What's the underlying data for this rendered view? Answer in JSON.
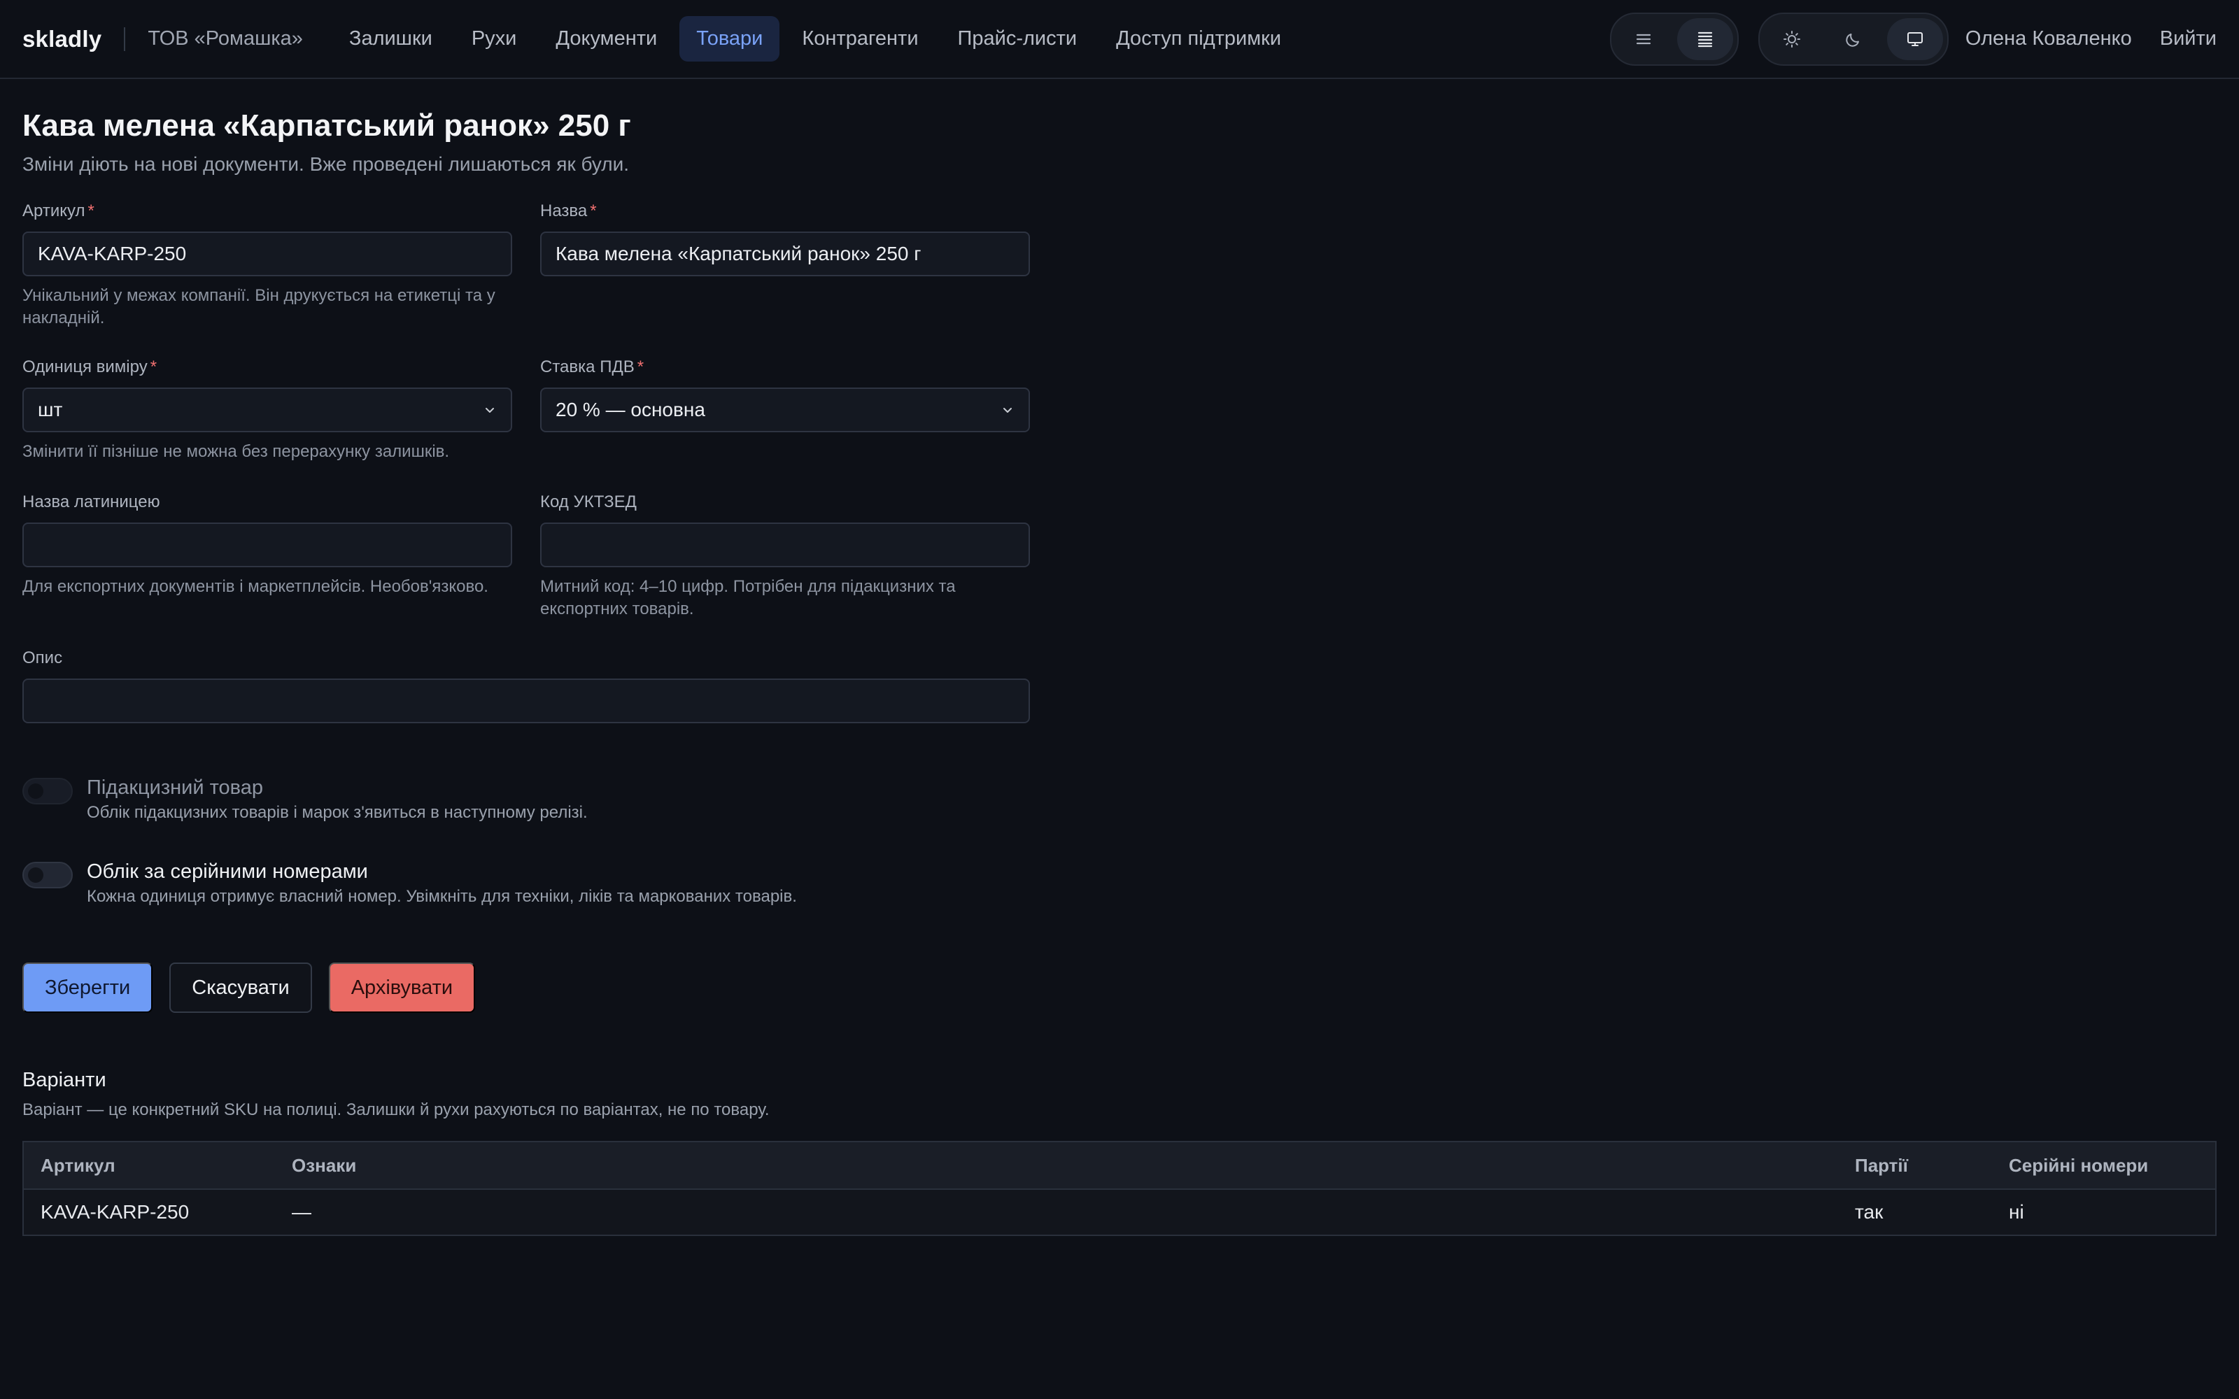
{
  "header": {
    "brand": "skladly",
    "company": "ТОВ «Ромашка»",
    "nav": [
      {
        "label": "Залишки"
      },
      {
        "label": "Рухи"
      },
      {
        "label": "Документи"
      },
      {
        "label": "Товари",
        "active": true
      },
      {
        "label": "Контрагенти"
      },
      {
        "label": "Прайс-листи"
      },
      {
        "label": "Доступ підтримки"
      }
    ],
    "density_icons": [
      "list-compact-icon",
      "list-dense-icon"
    ],
    "theme_icons": [
      "sun-icon",
      "moon-icon",
      "monitor-icon"
    ],
    "user": "Олена Коваленко",
    "logout": "Вийти"
  },
  "page": {
    "title": "Кава мелена «Карпатський ранок» 250 г",
    "subtitle": "Зміни діють на нові документи. Вже проведені лишаються як були."
  },
  "form": {
    "sku": {
      "label": "Артикул",
      "required": "*",
      "value": "KAVA-KARP-250",
      "hint": "Унікальний у межах компанії. Він друкується на етикетці та у накладній."
    },
    "name": {
      "label": "Назва",
      "required": "*",
      "value": "Кава мелена «Карпатський ранок» 250 г"
    },
    "unit": {
      "label": "Одиниця виміру",
      "required": "*",
      "value": "шт",
      "hint": "Змінити її пізніше не можна без перерахунку залишків."
    },
    "vat": {
      "label": "Ставка ПДВ",
      "required": "*",
      "value": "20 % — основна"
    },
    "latin_name": {
      "label": "Назва латиницею",
      "value": "",
      "hint": "Для експортних документів і маркетплейсів. Необов'язково."
    },
    "uktzed": {
      "label": "Код УКТЗЕД",
      "value": "",
      "hint": "Митний код: 4–10 цифр. Потрібен для підакцизних та експортних товарів."
    },
    "description": {
      "label": "Опис",
      "value": ""
    },
    "excise": {
      "title": "Підакцизний товар",
      "desc": "Облік підакцизних товарів і марок з'явиться в наступному релізі.",
      "on": false,
      "disabled": true
    },
    "serials": {
      "title": "Облік за серійними номерами",
      "desc": "Кожна одиниця отримує власний номер. Увімкніть для техніки, ліків та маркованих товарів.",
      "on": false
    }
  },
  "actions": {
    "save": "Зберегти",
    "cancel": "Скасувати",
    "archive": "Архівувати"
  },
  "variants": {
    "title": "Варіанти",
    "desc": "Варіант — це конкретний SKU на полиці. Залишки й рухи рахуються по варіантах, не по товару.",
    "columns": [
      "Артикул",
      "Ознаки",
      "Партії",
      "Серійні номери"
    ],
    "rows": [
      [
        "KAVA-KARP-250",
        "—",
        "так",
        "ні"
      ]
    ]
  },
  "colors": {
    "background": "#0d1017",
    "accent": "#7aa2f7",
    "primary_button": "#6e9bf5",
    "danger_button": "#ea6a64",
    "required": "#f07070"
  }
}
